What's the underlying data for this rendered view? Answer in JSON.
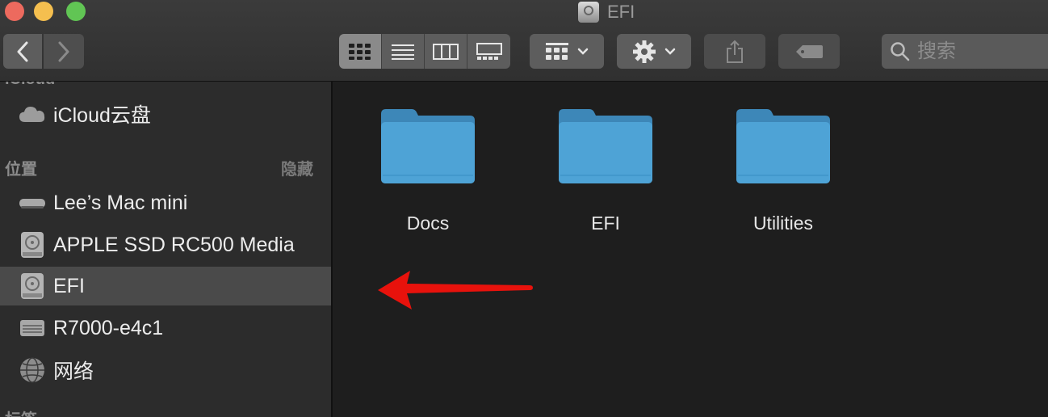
{
  "window": {
    "title": "EFI"
  },
  "toolbar": {
    "view_modes": [
      "icon-view",
      "list-view",
      "column-view",
      "gallery-view"
    ],
    "search_placeholder": "搜索"
  },
  "sidebar": {
    "cut_top_label": "iCloud",
    "icloud_item": "iCloud云盘",
    "locations_header": "位置",
    "hide_label": "隐藏",
    "items": [
      {
        "label": "Lee’s Mac mini",
        "icon": "mac-mini-icon"
      },
      {
        "label": "APPLE SSD RC500 Media",
        "icon": "disk-icon"
      },
      {
        "label": "EFI",
        "icon": "disk-icon",
        "selected": true
      },
      {
        "label": "R7000-e4c1",
        "icon": "server-icon"
      },
      {
        "label": "网络",
        "icon": "network-globe-icon"
      }
    ],
    "cut_bottom_label": "标签"
  },
  "main": {
    "folders": [
      {
        "name": "Docs"
      },
      {
        "name": "EFI"
      },
      {
        "name": "Utilities"
      }
    ]
  },
  "colors": {
    "folder": "#4ea3d6",
    "arrow": "#e8120c",
    "selection": "#4a4a4a"
  }
}
